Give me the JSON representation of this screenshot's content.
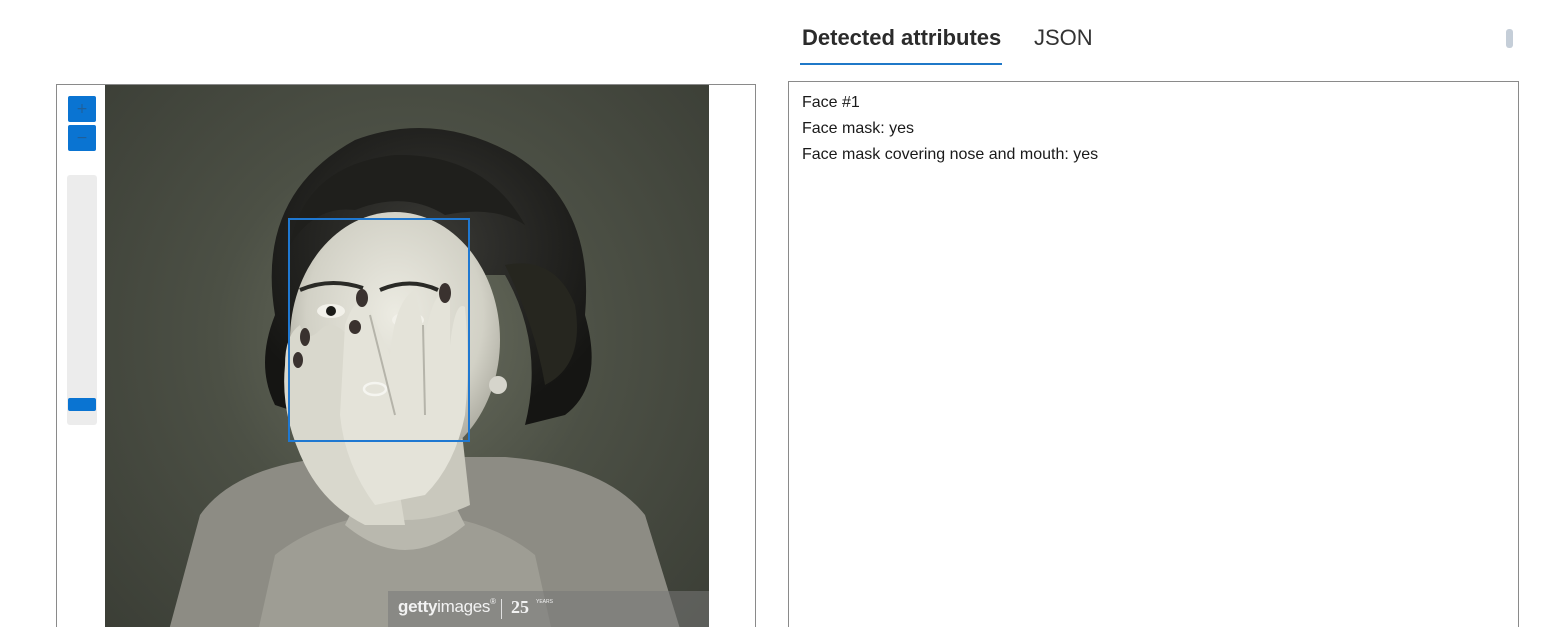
{
  "tabs": [
    {
      "label": "Detected attributes",
      "active": true
    },
    {
      "label": "JSON",
      "active": false
    }
  ],
  "viewer": {
    "zoom_in_label": "+",
    "zoom_out_label": "−",
    "zoom_level": 0.06
  },
  "watermark": {
    "brand_bold": "getty",
    "brand_rest": "images",
    "registered": "®",
    "anniversary": "25",
    "anniversary_suffix": "YEARS"
  },
  "results": {
    "lines": [
      "Face #1",
      "Face mask: yes",
      "Face mask covering nose and mouth: yes"
    ]
  },
  "colors": {
    "accent": "#0a74d2",
    "face_box": "#1f78d1",
    "tab_underline": "#1f78c8"
  }
}
